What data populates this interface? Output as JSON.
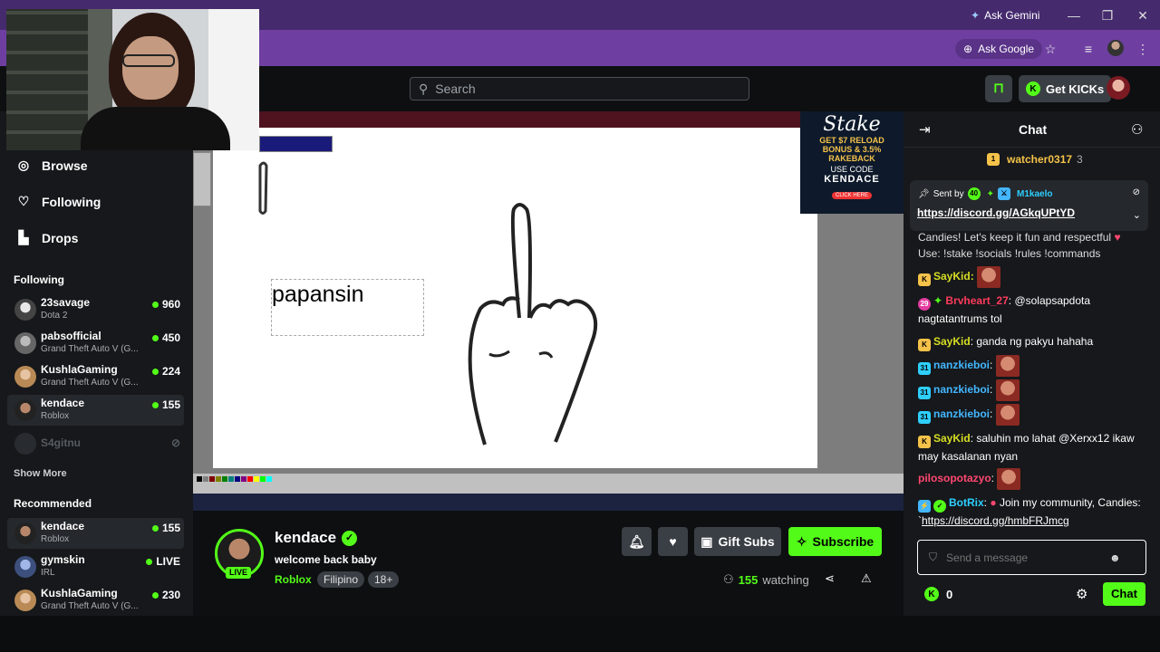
{
  "browser": {
    "ask_gemini": "Ask Gemini",
    "ask_google": "Ask Google",
    "minimize": "—",
    "restore": "❐",
    "close": "✕"
  },
  "header": {
    "search_placeholder": "Search",
    "get_kicks": "Get KICKs"
  },
  "sidebar": {
    "nav": [
      {
        "label": "Browse",
        "icon": "compass-icon"
      },
      {
        "label": "Following",
        "icon": "heart-icon"
      },
      {
        "label": "Drops",
        "icon": "chart-icon"
      }
    ],
    "following_heading": "Following",
    "following": [
      {
        "name": "23savage",
        "game": "Dota 2",
        "viewers": "960"
      },
      {
        "name": "pabsofficial",
        "game": "Grand Theft Auto V (G...",
        "viewers": "450"
      },
      {
        "name": "KushlaGaming",
        "game": "Grand Theft Auto V (G...",
        "viewers": "224"
      },
      {
        "name": "kendace",
        "game": "Roblox",
        "viewers": "155"
      },
      {
        "name": "S4gitnu",
        "game": "",
        "viewers": ""
      }
    ],
    "show_more": "Show More",
    "recommended_heading": "Recommended",
    "recommended": [
      {
        "name": "kendace",
        "game": "Roblox",
        "viewers": "155"
      },
      {
        "name": "gymskin",
        "game": "IRL",
        "viewers": "LIVE"
      },
      {
        "name": "KushlaGaming",
        "game": "Grand Theft Auto V (G...",
        "viewers": "230"
      }
    ]
  },
  "video": {
    "paint_text": "papansin",
    "ad": {
      "logo": "Stake",
      "line1": "GET $7 RELOAD",
      "line2": "BONUS & 3.5%",
      "line3": "RAKEBACK",
      "use_code": "USE CODE",
      "code": "KENDACE",
      "cta": "CLICK HERE"
    }
  },
  "stream": {
    "streamer": "kendace",
    "live": "LIVE",
    "title": "welcome back baby",
    "category": "Roblox",
    "tags": [
      "Filipino",
      "18+"
    ],
    "gift_subs": "Gift Subs",
    "subscribe": "Subscribe",
    "viewers": "155",
    "watching_label": "watching"
  },
  "chat": {
    "title": "Chat",
    "gift_leader": "watcher0317",
    "gift_leader_count": "3",
    "pinned": {
      "sent_by": "Sent by",
      "badge": "40",
      "user": "M1kaelo",
      "link": "https://discord.gg/AGkqUPtYD"
    },
    "messages": [
      {
        "text1": "Candies! Let's keep it fun and respectful",
        "text2": "Use: !stake !socials !rules !commands"
      },
      {
        "user": "SayKid",
        "text": ""
      },
      {
        "badge": "29",
        "user": "Brvheart_27",
        "text": "@solapsapdota nagtatantrums tol"
      },
      {
        "user": "SayKid",
        "text": "ganda ng pakyu hahaha"
      },
      {
        "badge": "31",
        "user": "nanzkieboi",
        "text": ""
      },
      {
        "badge": "31",
        "user": "nanzkieboi",
        "text": ""
      },
      {
        "badge": "31",
        "user": "nanzkieboi",
        "text": ""
      },
      {
        "user": "SayKid",
        "text": "saluhin mo lahat @Xerxx12 ikaw may kasalanan nyan"
      },
      {
        "user": "pilosopotazyo",
        "text": ""
      },
      {
        "user": "BotRix",
        "text": "Join my community, Candies: `",
        "link": "https://discord.gg/hmbFRJmcg"
      }
    ],
    "input_placeholder": "Send a message",
    "kicks": "0",
    "send": "Chat"
  }
}
